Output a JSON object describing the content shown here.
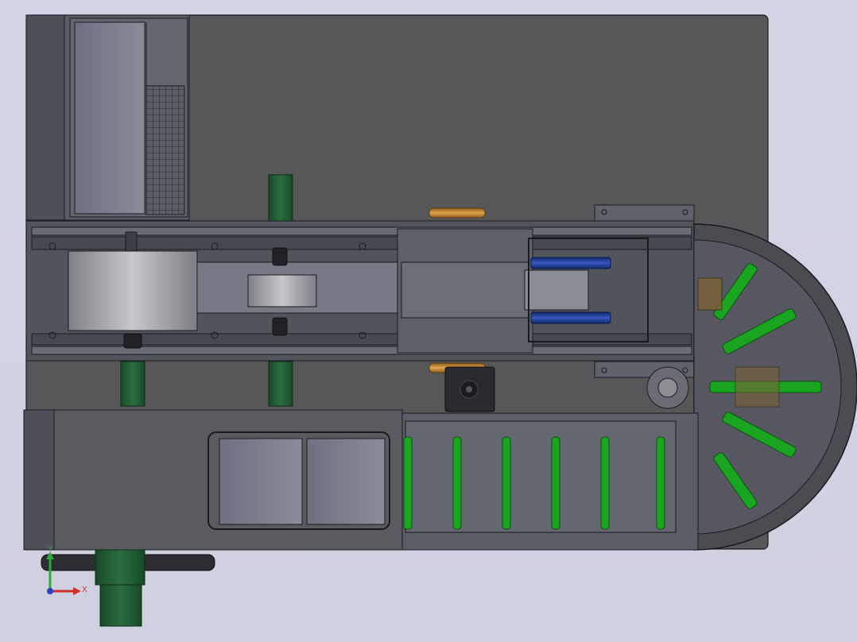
{
  "viewport": {
    "background": "#d0d1e3",
    "view": "top"
  },
  "triad": {
    "x_label": "X",
    "y_label": "Y",
    "x_color": "#d0302a",
    "y_color": "#2fa83a",
    "z_color": "#2b3fc7"
  },
  "colors": {
    "frame": "#555558",
    "frame_light": "#66676c",
    "steel": "#4a4c57",
    "green_part": "#1f5c33",
    "bright_green": "#1aa521",
    "brass": "#c0842f",
    "blue_part": "#1f3f9e",
    "roller": "#9d9ea3",
    "edge": "#1b1b1f"
  },
  "components": {
    "control_cabinet": "control-cabinet",
    "main_rail": "linear-rail-assembly",
    "large_roller": "large-film-roller",
    "small_roller": "small-film-roller",
    "indexing_disc": "rotary-indexing-disc",
    "conveyor": "chain-conveyor",
    "stepper_motor": "stepper-motor",
    "bottom_window": "inspection-window"
  }
}
